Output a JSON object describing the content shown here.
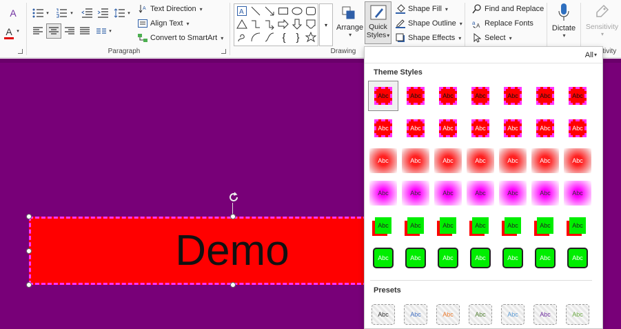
{
  "ribbon": {
    "paragraph": {
      "text_direction": "Text Direction",
      "align_text": "Align Text",
      "convert_smartart": "Convert to SmartArt",
      "group_label": "Paragraph"
    },
    "drawing": {
      "arrange": "Arrange",
      "quick_styles_line1": "Quick",
      "quick_styles_line2": "Styles",
      "shape_fill": "Shape Fill",
      "shape_outline": "Shape Outline",
      "shape_effects": "Shape Effects",
      "group_label": "Drawing"
    },
    "editing": {
      "find_replace": "Find and Replace",
      "replace_fonts": "Replace Fonts",
      "select": "Select"
    },
    "voice": {
      "dictate": "Dictate"
    },
    "sensitivity": {
      "label": "Sensitivity",
      "group_fragment": "itivity"
    }
  },
  "slide": {
    "shape_text": "Demo",
    "background_color": "#780078",
    "shape_fill": "#ff0000",
    "shape_outline": "#ff33ff"
  },
  "gallery": {
    "filter": "All",
    "theme_styles_heading": "Theme Styles",
    "presets_heading": "Presets",
    "swatch_text": "Abc",
    "preset_colors": [
      "#333333",
      "#4472c4",
      "#ed7d31",
      "#548235",
      "#5b9bd5",
      "#7030a0",
      "#70ad47"
    ]
  }
}
